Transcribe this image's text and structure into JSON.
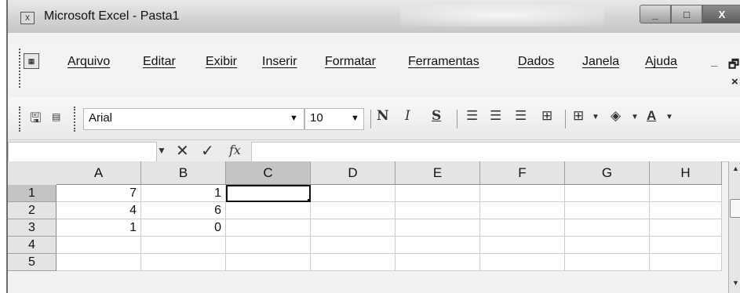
{
  "window": {
    "title": "Microsoft Excel - Pasta1",
    "controls": {
      "minimize": "_",
      "maximize": "□",
      "close": "X"
    }
  },
  "menu": {
    "items": [
      "Arquivo",
      "Editar",
      "Exibir",
      "Inserir",
      "Formatar",
      "Ferramentas",
      "Dados",
      "Janela",
      "Ajuda"
    ],
    "restore_icon": "🗗",
    "close_doc": "×"
  },
  "toolbar": {
    "font_name": "Arial",
    "font_size": "10",
    "bold": "N",
    "italic": "I",
    "underline": "S",
    "icons": [
      "save-icon",
      "align-left-icon",
      "align-center-icon",
      "align-right-icon",
      "merge-center-icon",
      "borders-icon",
      "fill-color-icon",
      "font-color-icon"
    ]
  },
  "formula_bar": {
    "cancel": "✕",
    "enter": "✓",
    "fx": "fx",
    "value": ""
  },
  "sheet": {
    "columns": [
      "A",
      "B",
      "C",
      "D",
      "E",
      "F",
      "G",
      "H"
    ],
    "rows": [
      "1",
      "2",
      "3",
      "4",
      "5"
    ],
    "cells": [
      [
        "7",
        "1",
        "",
        "",
        "",
        "",
        "",
        ""
      ],
      [
        "4",
        "6",
        "",
        "",
        "",
        "",
        "",
        ""
      ],
      [
        "1",
        "0",
        "",
        "",
        "",
        "",
        "",
        ""
      ],
      [
        "",
        "",
        "",
        "",
        "",
        "",
        "",
        ""
      ],
      [
        "",
        "",
        "",
        "",
        "",
        "",
        "",
        ""
      ]
    ],
    "active_cell": "C1"
  }
}
